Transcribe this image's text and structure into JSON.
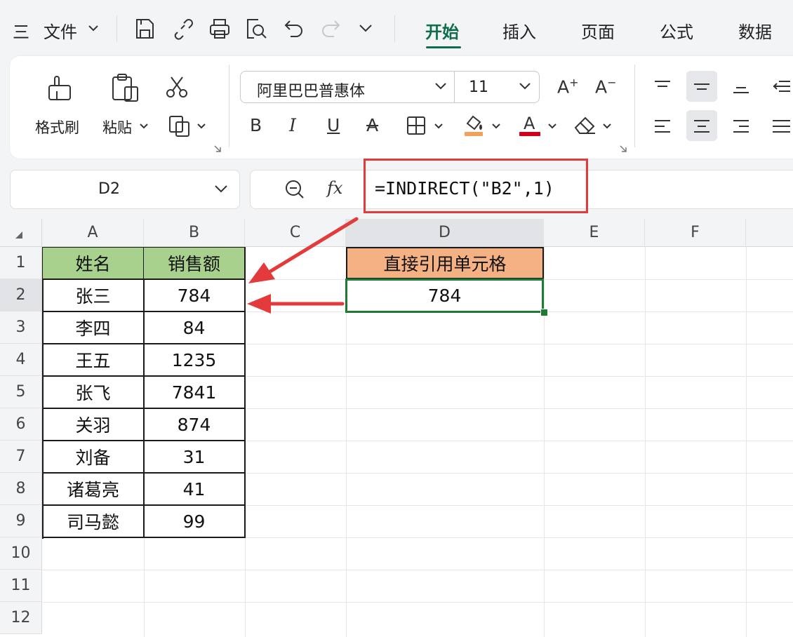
{
  "menu": {
    "hamburger": "三",
    "file_label": "文件",
    "tabs": [
      "开始",
      "插入",
      "页面",
      "公式",
      "数据"
    ],
    "active_tab": "开始"
  },
  "ribbon": {
    "format_painter": "格式刷",
    "paste": "粘贴",
    "font_name": "阿里巴巴普惠体",
    "font_size": "11",
    "bold": "B",
    "italic": "I",
    "underline": "U",
    "font_color_accent": "#d0021b",
    "fill_color_accent": "#f0a15b"
  },
  "formula_bar": {
    "cell_ref": "D2",
    "fx": "fx",
    "formula": "=INDIRECT(\"B2\",1)"
  },
  "sheet": {
    "columns": [
      "A",
      "B",
      "C",
      "D",
      "E",
      "F"
    ],
    "rows": [
      "1",
      "2",
      "3",
      "4",
      "5",
      "6",
      "7",
      "8",
      "9",
      "10",
      "11",
      "12"
    ],
    "table_header": [
      "姓名",
      "销售额"
    ],
    "table_rows": [
      [
        "张三",
        "784"
      ],
      [
        "李四",
        "84"
      ],
      [
        "王五",
        "1235"
      ],
      [
        "张飞",
        "7841"
      ],
      [
        "关羽",
        "874"
      ],
      [
        "刘备",
        "31"
      ],
      [
        "诸葛亮",
        "41"
      ],
      [
        "司马懿",
        "99"
      ]
    ],
    "d1_label": "直接引用单元格",
    "d2_value": "784",
    "header_green": "#a9d18e",
    "header_orange": "#f4b183",
    "selection_green": "#1e7b34",
    "arrow_red": "#e33b3b"
  }
}
